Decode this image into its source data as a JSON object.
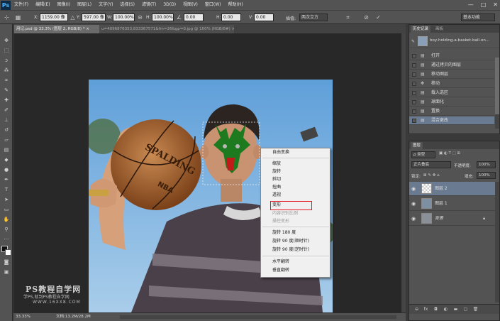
{
  "app": {
    "logo": "Ps"
  },
  "menu": [
    "文件(F)",
    "编辑(E)",
    "图像(I)",
    "图层(L)",
    "文字(Y)",
    "选择(S)",
    "滤镜(T)",
    "3D(D)",
    "视图(V)",
    "窗口(W)",
    "帮助(H)"
  ],
  "window_controls": {
    "minimize": "—",
    "maximize": "□",
    "close": "✕"
  },
  "options": {
    "x_label": "X:",
    "x_value": "1159.00 像",
    "y_label": "Y:",
    "y_value": "597.00 像",
    "w_label": "W:",
    "w_value": "100.00%",
    "h_label": "H:",
    "h_value": "100.00%",
    "angle_value": "0.00",
    "hskew_label": "H:",
    "hskew_value": "0.00",
    "vskew_label": "V:",
    "vskew_value": "0.00",
    "interp_label": "插值:",
    "interp_value": "两次立方",
    "workspace": "基本功能"
  },
  "tabs": {
    "active": "用记.psd @ 33.3% (图层 2, RGB/8) * ×",
    "inactive": "u=4096876353,833367571&fm=26&gp=0.jpg @ 100% (RGB/8#) ×"
  },
  "status": {
    "zoom": "33.33%",
    "doc": "文档:13.2M/28.2M"
  },
  "context_menu": {
    "items": [
      "自由变换",
      "缩放",
      "旋转",
      "斜切",
      "扭曲",
      "透视",
      "变形",
      "内容识别比例",
      "操控变形",
      "旋转 180 度",
      "旋转 90 度(顺时针)",
      "旋转 90 度(逆时针)",
      "水平翻转",
      "垂直翻转"
    ],
    "highlighted": "变形",
    "highlight_color": "#e3141b"
  },
  "history": {
    "tabs": [
      "历史记录",
      "画板"
    ],
    "snapshot": "boy-holding-a-basket-ball-on...",
    "items": [
      "打开",
      "通过拷贝的图层",
      "移动图层",
      "移动",
      "载入选区",
      "球面化",
      "置换",
      "混合更改"
    ],
    "selected": "混合更改"
  },
  "layers": {
    "tab": "图层",
    "kind": "ρ 类型",
    "blend_mode": "正片叠底",
    "opacity_label": "不透明度:",
    "opacity_value": "100%",
    "lock_label": "锁定:",
    "fill_label": "填充:",
    "fill_value": "100%",
    "items": [
      {
        "name": "图层 2",
        "selected": true
      },
      {
        "name": "图层 1",
        "selected": false
      },
      {
        "name": "背景",
        "selected": false,
        "locked": true
      }
    ]
  },
  "watermark": {
    "line1": "PS教程自学网",
    "line2": "学PS,就到PS教程自学网",
    "line3": "WWW.16XX8.COM"
  },
  "photo_text": {
    "ball": "SPALDING",
    "nba": "NBA"
  }
}
